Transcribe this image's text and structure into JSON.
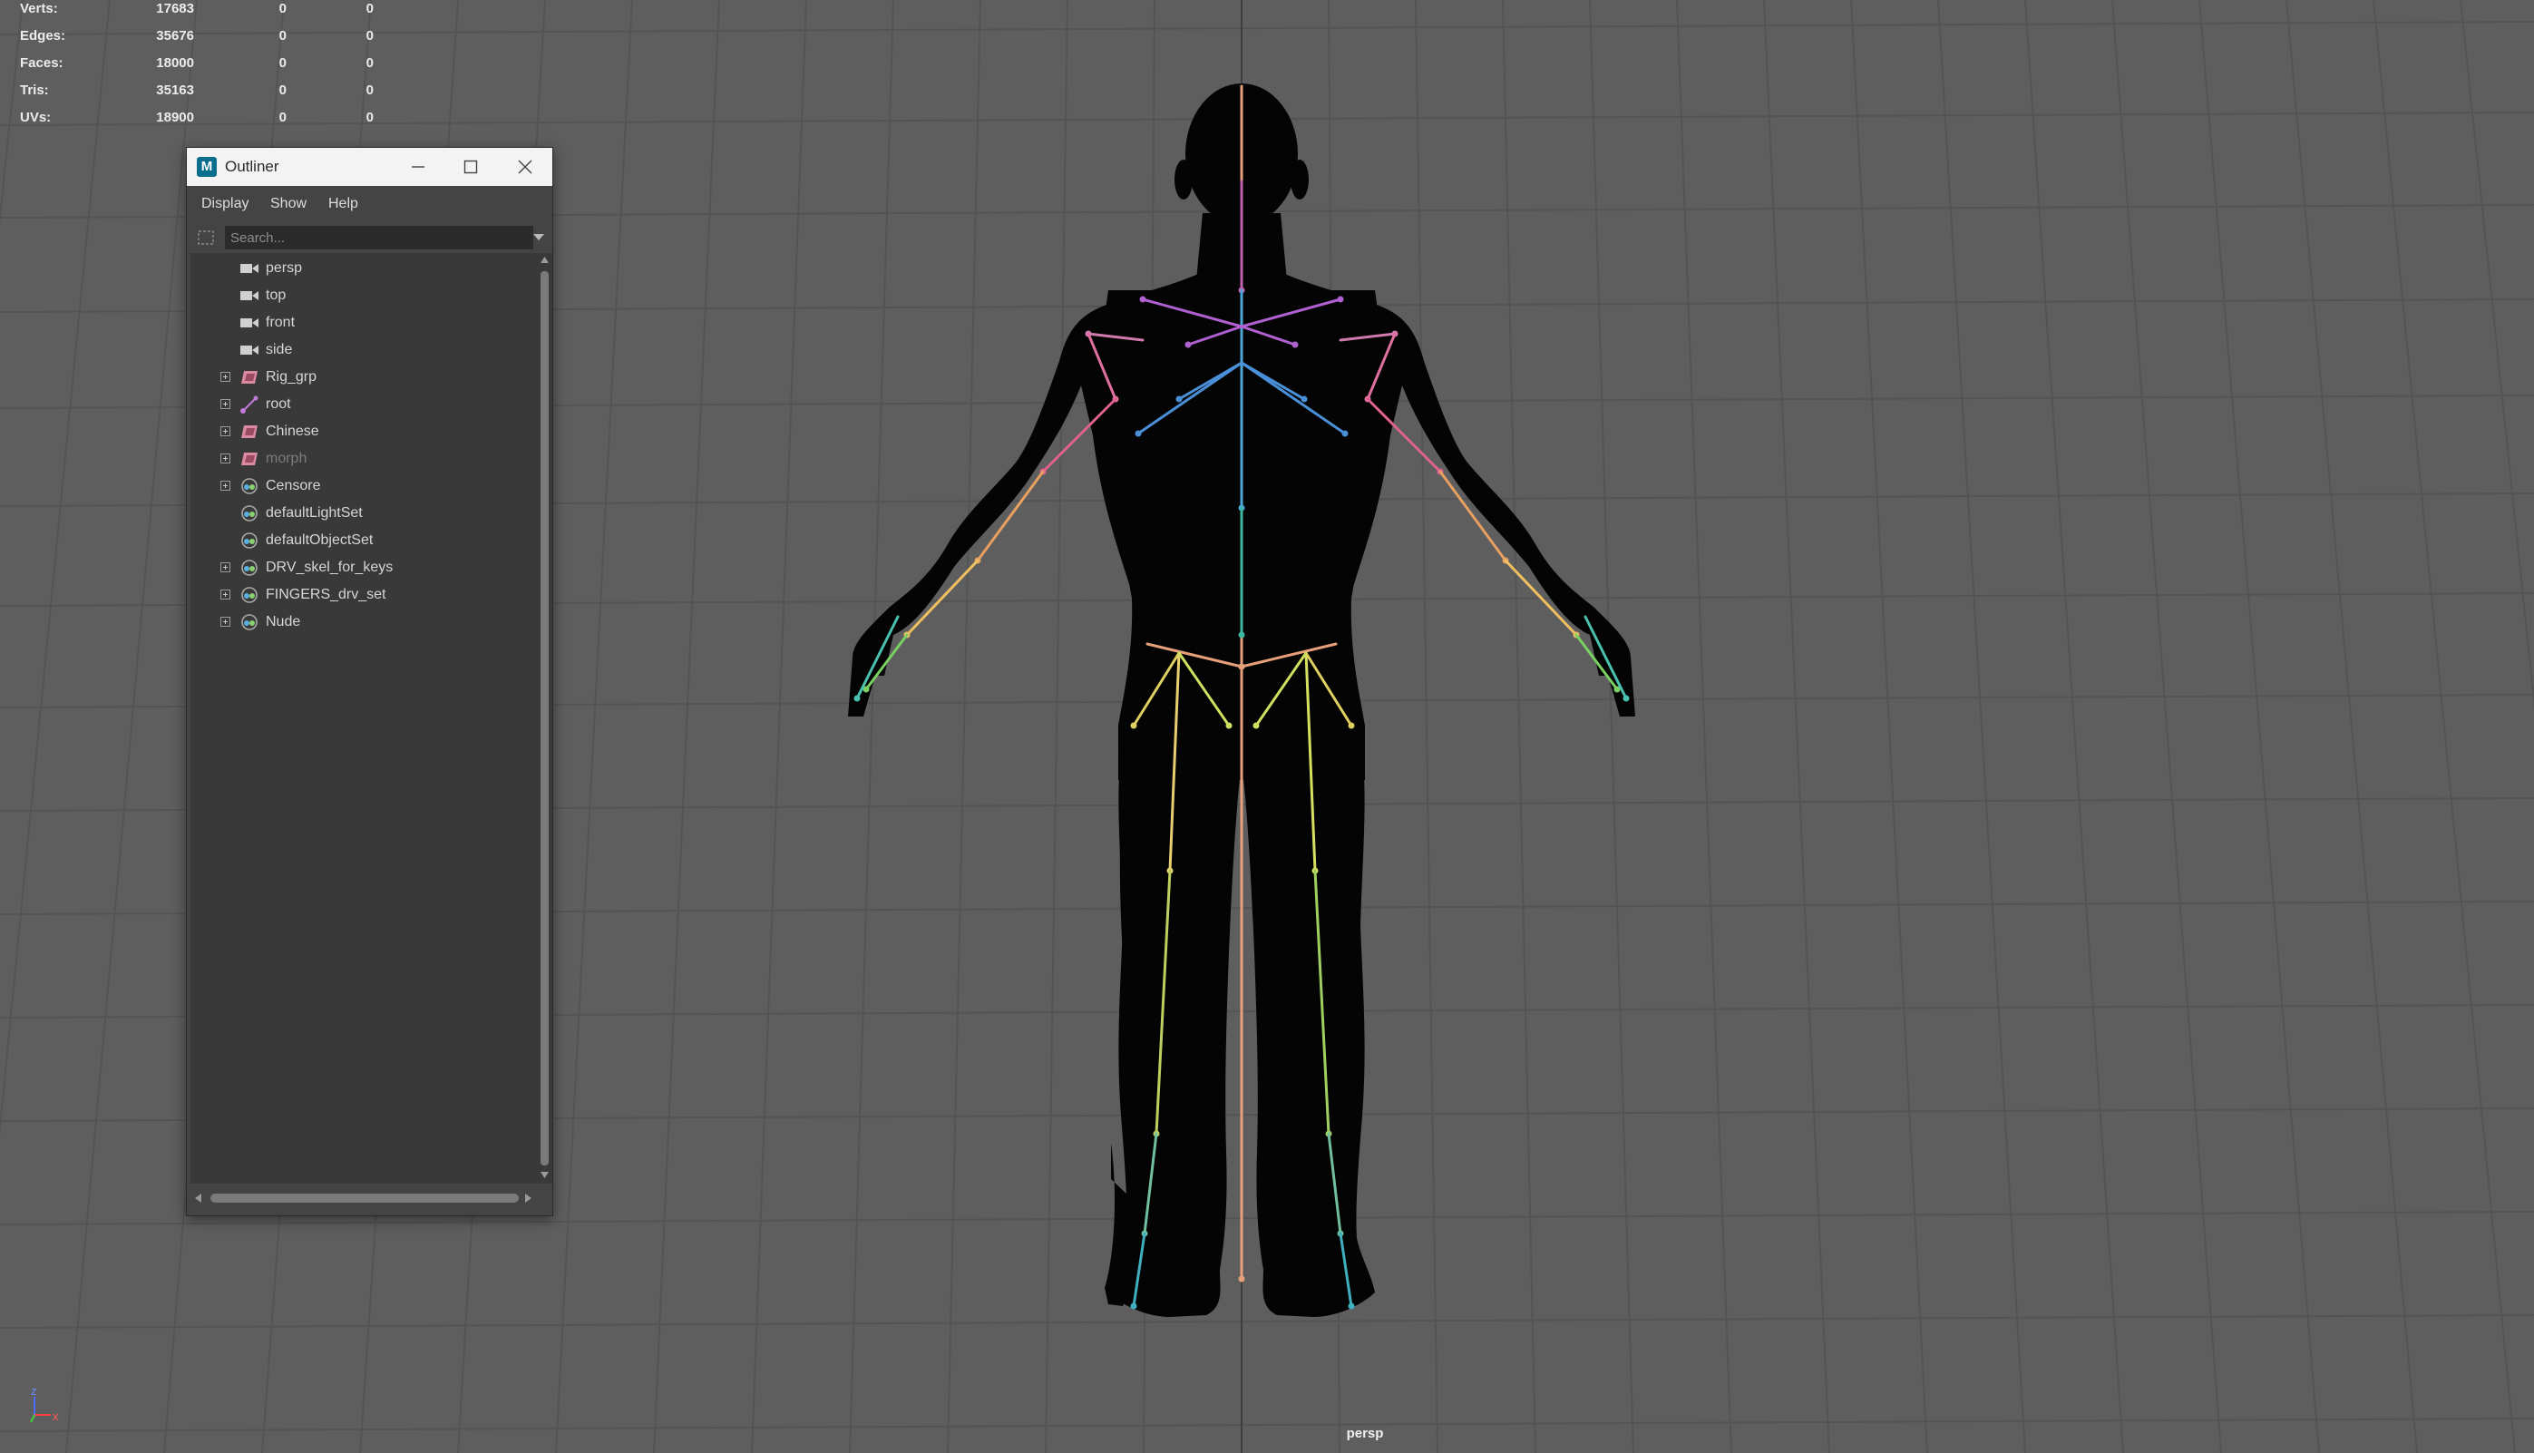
{
  "hud": {
    "rows": [
      {
        "label": "Verts:",
        "v1": "17683",
        "v2": "0",
        "v3": "0"
      },
      {
        "label": "Edges:",
        "v1": "35676",
        "v2": "0",
        "v3": "0"
      },
      {
        "label": "Faces:",
        "v1": "18000",
        "v2": "0",
        "v3": "0"
      },
      {
        "label": "Tris:",
        "v1": "35163",
        "v2": "0",
        "v3": "0"
      },
      {
        "label": "UVs:",
        "v1": "18900",
        "v2": "0",
        "v3": "0"
      }
    ]
  },
  "viewport": {
    "camera_label": "persp",
    "background_color": "#5e5e5e",
    "axis_labels": {
      "z": "z",
      "y": "y",
      "x": "x"
    }
  },
  "outliner": {
    "title": "Outliner",
    "app_icon": "M",
    "menu": [
      "Display",
      "Show",
      "Help"
    ],
    "search_placeholder": "Search...",
    "items": [
      {
        "label": "persp",
        "icon": "camera-icon",
        "expandable": false,
        "dim": false
      },
      {
        "label": "top",
        "icon": "camera-icon",
        "expandable": false,
        "dim": false
      },
      {
        "label": "front",
        "icon": "camera-icon",
        "expandable": false,
        "dim": false
      },
      {
        "label": "side",
        "icon": "camera-icon",
        "expandable": false,
        "dim": false
      },
      {
        "label": "Rig_grp",
        "icon": "group-icon",
        "expandable": true,
        "dim": false
      },
      {
        "label": "root",
        "icon": "joint-icon",
        "expandable": true,
        "dim": false
      },
      {
        "label": "Chinese",
        "icon": "group-icon",
        "expandable": true,
        "dim": false
      },
      {
        "label": "morph",
        "icon": "group-icon",
        "expandable": true,
        "dim": true
      },
      {
        "label": "Censore",
        "icon": "set-icon",
        "expandable": true,
        "dim": false
      },
      {
        "label": "defaultLightSet",
        "icon": "set-icon",
        "expandable": false,
        "dim": false
      },
      {
        "label": "defaultObjectSet",
        "icon": "set-icon",
        "expandable": false,
        "dim": false
      },
      {
        "label": "DRV_skel_for_keys",
        "icon": "set-icon",
        "expandable": true,
        "dim": false
      },
      {
        "label": "FINGERS_drv_set",
        "icon": "set-icon",
        "expandable": true,
        "dim": false
      },
      {
        "label": "Nude",
        "icon": "set-icon",
        "expandable": true,
        "dim": false
      }
    ]
  }
}
